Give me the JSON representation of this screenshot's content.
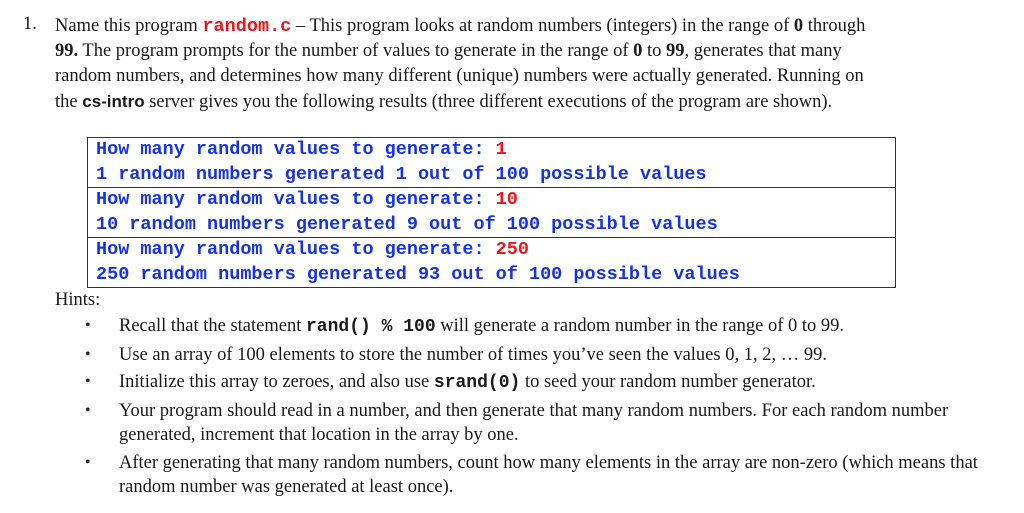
{
  "question": {
    "number": "1.",
    "lines": [
      {
        "parts": [
          {
            "text": "Name this program ",
            "style": "normal"
          },
          {
            "text": "random.c",
            "style": "code-red"
          },
          {
            "text": " – This program looks at random numbers (integers) in the range of ",
            "style": "normal"
          },
          {
            "text": "0",
            "style": "bold"
          },
          {
            "text": " through",
            "style": "normal"
          }
        ]
      },
      {
        "parts": [
          {
            "text": "99.",
            "style": "bold"
          },
          {
            "text": "  The program prompts for the number of values to generate in the range of ",
            "style": "normal"
          },
          {
            "text": "0",
            "style": "bold"
          },
          {
            "text": " to ",
            "style": "normal"
          },
          {
            "text": "99",
            "style": "bold"
          },
          {
            "text": ", generates that many",
            "style": "normal"
          }
        ]
      },
      {
        "parts": [
          {
            "text": "random numbers, and determines how many different (unique) numbers were actually generated.  Running on",
            "style": "normal"
          }
        ]
      },
      {
        "parts": [
          {
            "text": "the ",
            "style": "normal"
          },
          {
            "text": "cs-intro",
            "style": "sans-bold"
          },
          {
            "text": " server gives you the following results (three different executions of the program are shown).",
            "style": "normal"
          }
        ]
      }
    ]
  },
  "terminal": {
    "runs": [
      {
        "prompt": "How many random values to generate: ",
        "input": "1",
        "result": "1 random numbers generated 1 out of 100 possible values"
      },
      {
        "prompt": "How many random values to generate: ",
        "input": "10",
        "result": "10 random numbers generated 9 out of 100 possible values"
      },
      {
        "prompt": "How many random values to generate: ",
        "input": "250",
        "result": "250 random numbers generated 93 out of 100 possible values"
      }
    ],
    "colors": {
      "text": "#1433e6",
      "input": "#e8171b"
    }
  },
  "hints": {
    "label": "Hints:",
    "bullet_icon": "•",
    "items": [
      {
        "parts": [
          {
            "text": "Recall that the statement ",
            "style": "normal"
          },
          {
            "text": "rand() % 100",
            "style": "mono-bold"
          },
          {
            "text": " will generate a random number in the range of 0 to 99.",
            "style": "normal"
          }
        ]
      },
      {
        "parts": [
          {
            "text": "Use an array of 100 elements to store the number of times you’ve seen the values 0, 1, 2, … 99.",
            "style": "normal"
          }
        ]
      },
      {
        "parts": [
          {
            "text": "Initialize this array to zeroes, and also use ",
            "style": "normal"
          },
          {
            "text": "srand(0)",
            "style": "mono-bold"
          },
          {
            "text": "  to seed your random number generator.",
            "style": "normal"
          }
        ]
      },
      {
        "parts": [
          {
            "text": "Your program should read in a number, and then generate that many random numbers.  For each random number generated, increment that location in the array by one.",
            "style": "normal"
          }
        ]
      },
      {
        "parts": [
          {
            "text": "After generating that many random numbers, count how many elements in the array are non-zero (which means that random number was generated at least once).",
            "style": "normal"
          }
        ]
      }
    ]
  }
}
